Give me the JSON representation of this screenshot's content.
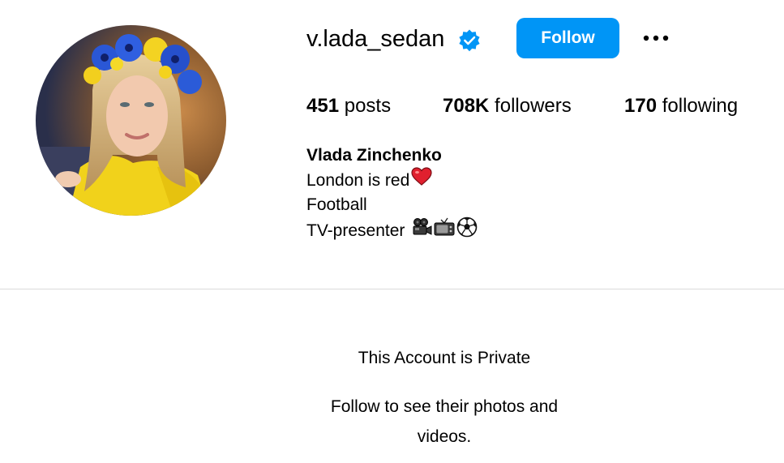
{
  "profile": {
    "username": "v.lada_sedan",
    "verified": true,
    "avatar_icon": "profile-photo",
    "follow_label": "Follow",
    "more_icon": "more-options-icon"
  },
  "stats": {
    "posts_count": "451",
    "posts_label": "posts",
    "followers_count": "708K",
    "followers_label": "followers",
    "following_count": "170",
    "following_label": "following"
  },
  "bio": {
    "full_name": "Vlada Zinchenko",
    "line1": "London is red",
    "line2": "Football",
    "line3": "TV-presenter",
    "line1_emoji": "red-heart",
    "line3_emojis": [
      "film-camera",
      "television",
      "soccer-ball"
    ]
  },
  "private_notice": {
    "title": "This Account is Private",
    "message": "Follow to see their photos and videos."
  },
  "colors": {
    "accent": "#0095f6",
    "divider": "#dbdbdb",
    "text": "#000000"
  }
}
